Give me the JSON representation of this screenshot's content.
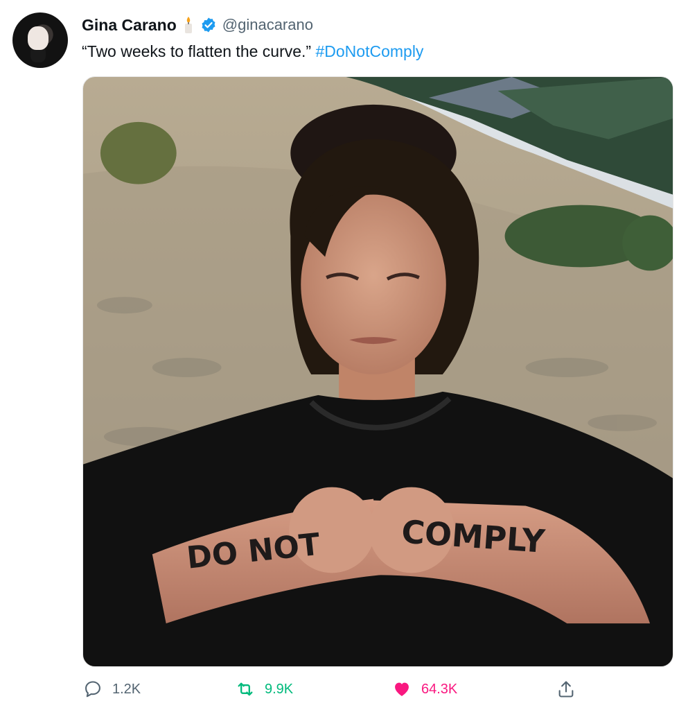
{
  "tweet": {
    "author_name": "Gina Carano",
    "handle": "@ginacarano",
    "text": "“Two weeks to flatten the curve.”",
    "hashtag": "#DoNotComply",
    "avatar_icon": "profile-photo",
    "name_emoji_icon": "candle-icon",
    "verified_icon": "verified-badge-icon"
  },
  "photo": {
    "left_arm_text": "DO NOT",
    "right_arm_text": "COMPLY"
  },
  "actions": {
    "reply_count": "1.2K",
    "retweet_count": "9.9K",
    "like_count": "64.3K"
  },
  "colors": {
    "link": "#1d9bf0",
    "secondary_text": "#536471",
    "retweet_active": "#00ba7c",
    "like_active": "#f91880"
  }
}
